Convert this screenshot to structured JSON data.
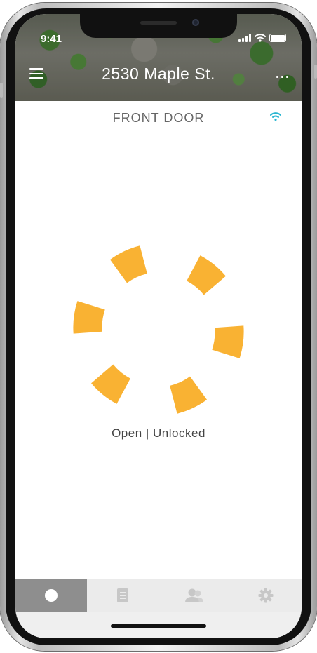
{
  "status_bar": {
    "time": "9:41",
    "signal_icon": "cellular-signal-icon",
    "wifi_icon": "wifi-icon",
    "battery_icon": "battery-icon"
  },
  "header": {
    "title": "2530 Maple St.",
    "menu_icon": "hamburger-menu-icon",
    "more_label": "···"
  },
  "door": {
    "name": "FRONT DOOR",
    "connection_icon": "wifi-connected-icon",
    "connection_color": "#29b6d1",
    "status": "Open | Unlocked",
    "lock_icon": "lock-status-ring-icon",
    "accent_color": "#f9b233"
  },
  "tabs": [
    {
      "icon": "circle-icon",
      "active": true
    },
    {
      "icon": "list-document-icon",
      "active": false
    },
    {
      "icon": "users-icon",
      "active": false
    },
    {
      "icon": "settings-gear-icon",
      "active": false
    }
  ]
}
